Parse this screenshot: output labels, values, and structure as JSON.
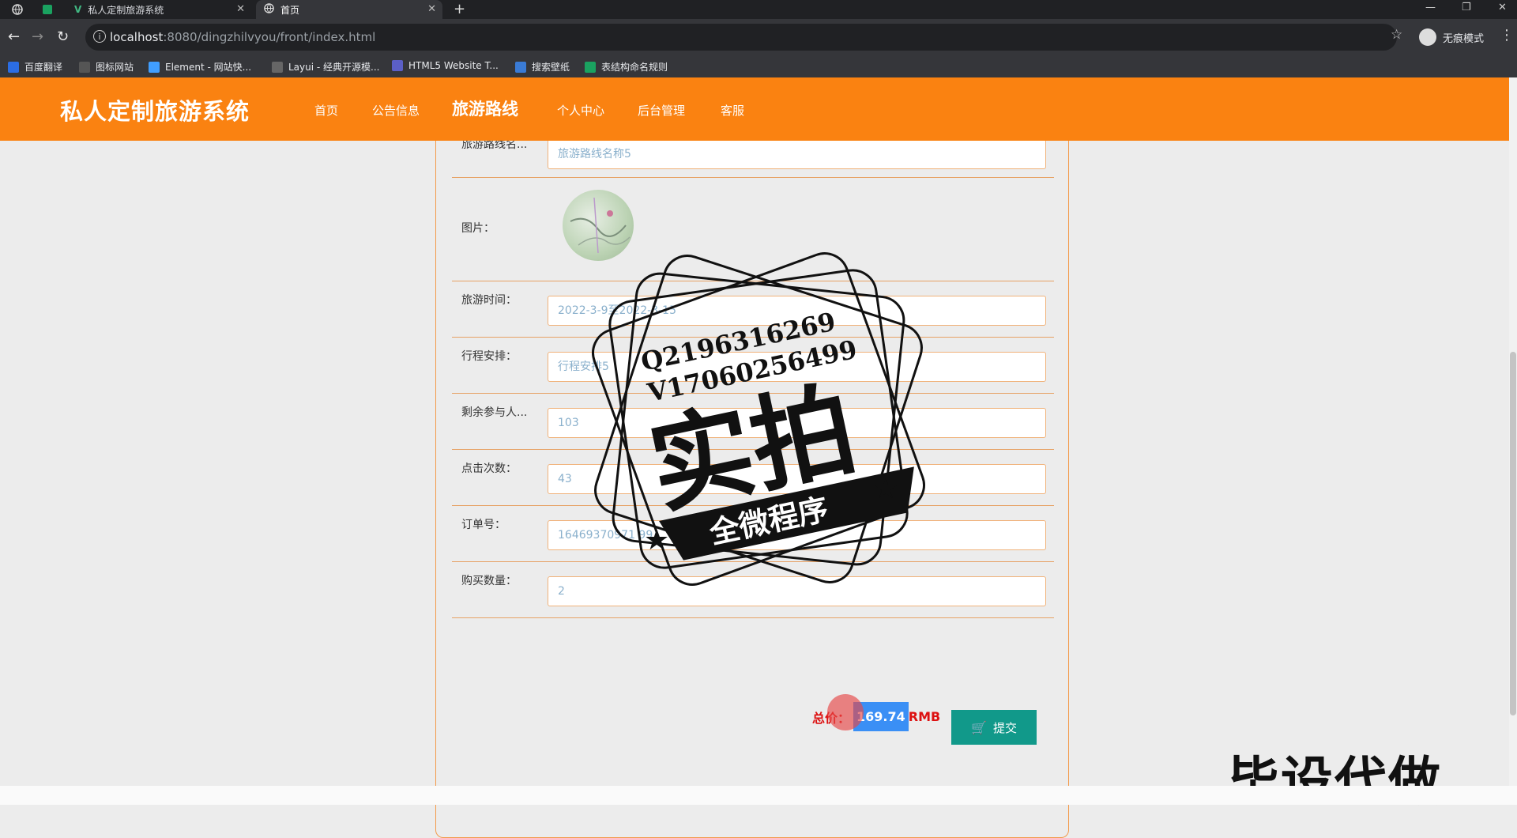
{
  "browser": {
    "tabs": [
      {
        "title": ""
      },
      {
        "title": ""
      },
      {
        "title": "私人定制旅游系统"
      },
      {
        "title": "首页"
      }
    ],
    "url_host": "localhost",
    "url_path": ":8080/dingzhilvyou/front/index.html",
    "incognito_label": "无痕模式",
    "bookmarks": [
      {
        "label": "百度翻译",
        "color": "#2b6de3"
      },
      {
        "label": "图标网站",
        "color": "#333333"
      },
      {
        "label": "Element - 网站快...",
        "color": "#409eff"
      },
      {
        "label": "Layui - 经典开源模...",
        "color": "#555555"
      },
      {
        "label": "HTML5 Website T...",
        "color": "#5b5fc7"
      },
      {
        "label": "搜索壁纸",
        "color": "#3a7bd5"
      },
      {
        "label": "表结构命名规则",
        "color": "#1aa260"
      }
    ]
  },
  "site": {
    "brand": "私人定制旅游系统",
    "nav": [
      "首页",
      "公告信息",
      "旅游路线",
      "个人中心",
      "后台管理",
      "客服"
    ],
    "accent": "#fa8211"
  },
  "form": {
    "rows": [
      {
        "label": "旅游路线名...",
        "value": "旅游路线名称5"
      },
      {
        "label": "图片：",
        "value": ""
      },
      {
        "label": "旅游时间：",
        "value": "2022-3-9至2022-3-15"
      },
      {
        "label": "行程安排：",
        "value": "行程安排5"
      },
      {
        "label": "剩余参与人...",
        "value": "103"
      },
      {
        "label": "点击次数：",
        "value": "43"
      },
      {
        "label": "订单号：",
        "value": "16469370971 99"
      },
      {
        "label": "购买数量：",
        "value": "2"
      }
    ],
    "total_label": "总价：",
    "total_value": "169.74",
    "total_unit": "RMB",
    "submit_label": "提交"
  },
  "watermark": {
    "line1": "Q2196316269",
    "line2": "V17060256499",
    "big": "实拍",
    "ribbon": "全微程序",
    "corner": "毕设代做"
  }
}
